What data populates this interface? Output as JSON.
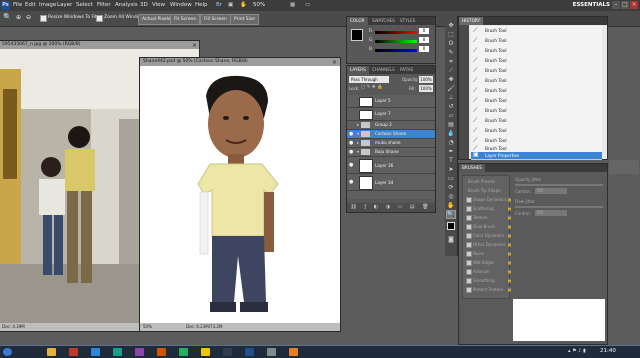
{
  "app": {
    "logo": "Ps",
    "menu": [
      "File",
      "Edit",
      "Image",
      "Layer",
      "Select",
      "Filter",
      "Analysis",
      "3D",
      "View",
      "Window",
      "Help"
    ],
    "zoom": "50%",
    "workspace": "ESSENTIALS"
  },
  "options": {
    "resize_label": "Resize Windows To Fit",
    "zoom_all_label": "Zoom All Windows",
    "actual_pixels": "Actual Pixels",
    "fit_screen": "Fit Screen",
    "fill_screen": "Fill Screen",
    "print_size": "Print Size"
  },
  "photo_doc": {
    "title": "595435667_n.jpg @ 100% (RGB/8)",
    "status": "Doc: 4.39M"
  },
  "main_doc": {
    "title": "Shane442.psd @ 50% (Cartoon Shane, RGB/8)",
    "zoom": "50%",
    "status": "Doc: 6.23M/73.2M"
  },
  "color_panel": {
    "tabs": [
      "COLOR",
      "SWATCHES",
      "STYLES"
    ],
    "channels": [
      {
        "label": "R",
        "value": "0"
      },
      {
        "label": "G",
        "value": "0"
      },
      {
        "label": "B",
        "value": "0"
      }
    ],
    "colors": {
      "foreground": "#000000",
      "background": "#ffffff"
    }
  },
  "layers_panel": {
    "tabs": [
      "LAYERS",
      "CHANNELS",
      "PATHS"
    ],
    "blend_mode": "Pass Through",
    "opacity_label": "Opacity:",
    "opacity": "100%",
    "lock_label": "Lock:",
    "fill_label": "Fill:",
    "fill": "100%",
    "layers": [
      {
        "name": "Layer 5",
        "type": "layer",
        "visible": false,
        "selected": false
      },
      {
        "name": "Layer 7",
        "type": "layer",
        "visible": false,
        "selected": false
      },
      {
        "name": "Group 2",
        "type": "group",
        "visible": false,
        "selected": false
      },
      {
        "name": "Cartoon Shane",
        "type": "group",
        "visible": true,
        "selected": true
      },
      {
        "name": "muka shane",
        "type": "group",
        "visible": true,
        "selected": false
      },
      {
        "name": "Baju Shane",
        "type": "group",
        "visible": true,
        "selected": false
      },
      {
        "name": "Layer 36",
        "type": "layer",
        "visible": true,
        "selected": false
      },
      {
        "name": "Layer 34",
        "type": "layer",
        "visible": true,
        "selected": false
      }
    ]
  },
  "history_panel": {
    "tab": "HISTORY",
    "items": [
      "Brush Tool",
      "Brush Tool",
      "Brush Tool",
      "Brush Tool",
      "Brush Tool",
      "Brush Tool",
      "Brush Tool",
      "Brush Tool",
      "Brush Tool",
      "Brush Tool",
      "Brush Tool",
      "Brush Tool",
      "Brush Tool",
      "Layer Properties"
    ],
    "selected_index": 13
  },
  "brushes_panel": {
    "tab": "BRUSHES",
    "items": [
      "Brush Presets",
      "Brush Tip Shape",
      "Shape Dynamics",
      "Scattering",
      "Texture",
      "Dual Brush",
      "Color Dynamics",
      "Other Dynamics",
      "Noise",
      "Wet Edges",
      "Airbrush",
      "Smoothing",
      "Protect Texture"
    ],
    "right_labels": [
      "Opacity Jitter",
      "Control:",
      "Off",
      "Flow Jitter",
      "Control:",
      "Off"
    ]
  },
  "taskbar": {
    "time": "21:40"
  }
}
